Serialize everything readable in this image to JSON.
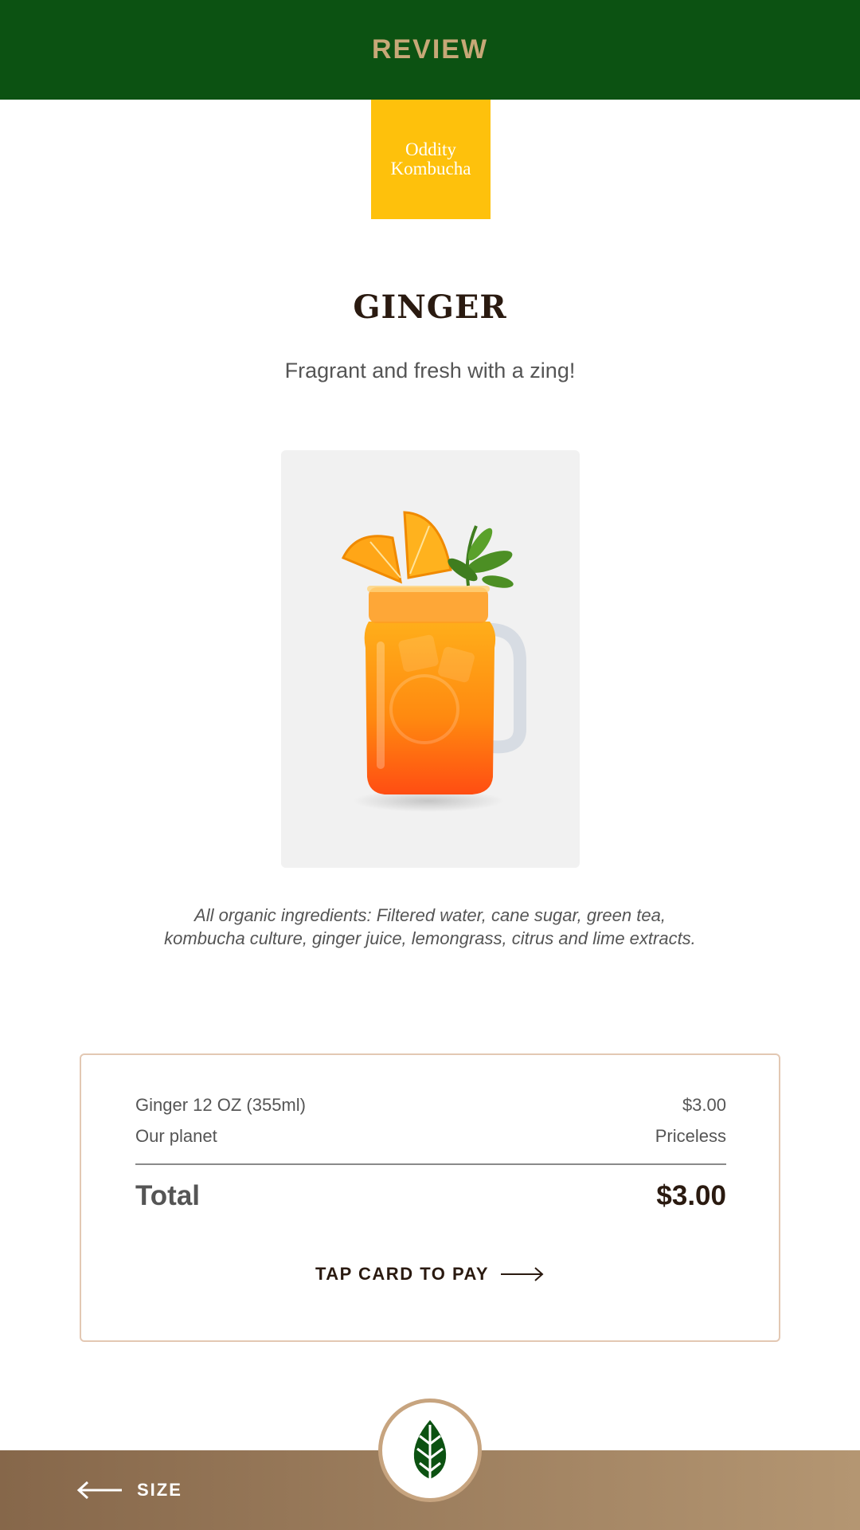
{
  "header": {
    "title": "REVIEW",
    "background": "#0c5212",
    "title_color": "#c7a877"
  },
  "brand": {
    "line1": "Oddity",
    "line2": "Kombucha",
    "color": "#fec10c"
  },
  "product": {
    "name": "GINGER",
    "tagline": "Fragrant and fresh with a zing!",
    "image": "ginger-kombucha-mason-jar-photo",
    "ingredients": "All organic ingredients: Filtered water, cane sugar, green tea, kombucha culture, ginger juice, lemongrass, citrus and lime extracts."
  },
  "order": {
    "items": [
      {
        "label": "Ginger 12 OZ (355ml)",
        "price": "$3.00"
      },
      {
        "label": "Our planet",
        "price": "Priceless"
      }
    ],
    "total_label": "Total",
    "total_amount": "$3.00",
    "pay_label": "TAP CARD TO PAY",
    "pay_icon": "arrow-right-icon"
  },
  "footer": {
    "back_label": "SIZE",
    "back_icon": "arrow-left-icon",
    "badge_icon": "leaf-icon",
    "gradient": [
      "#86674a",
      "#b49672"
    ]
  }
}
